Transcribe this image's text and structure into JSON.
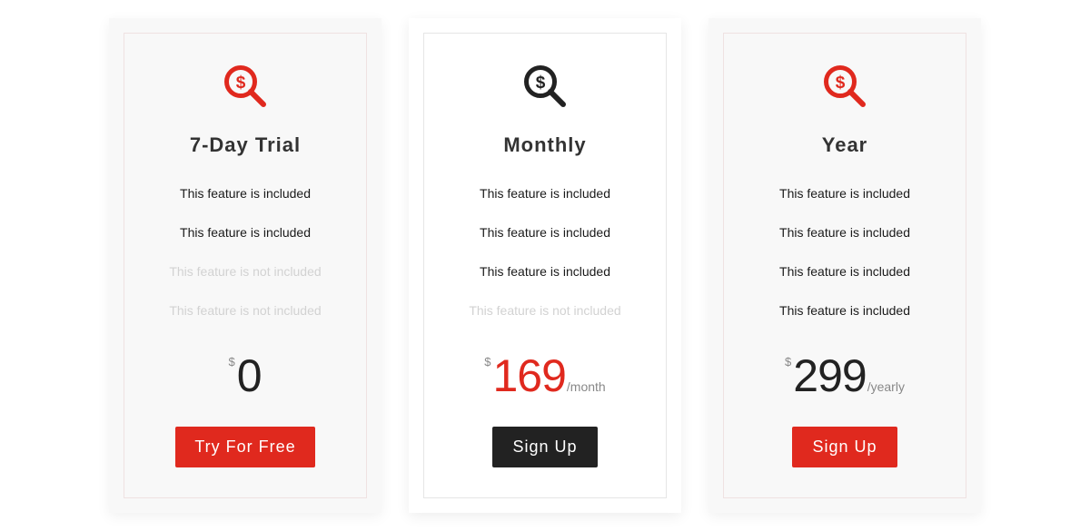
{
  "colors": {
    "accent": "#e0291e",
    "dark": "#222222",
    "disabled_text": "#d2d2d2",
    "card_bg": "#f8f8f8"
  },
  "plans": [
    {
      "icon": "dollar-search-icon",
      "icon_color": "#e0291e",
      "title": "7-Day Trial",
      "features": [
        {
          "text": "This feature is included",
          "included": true
        },
        {
          "text": "This feature is included",
          "included": true
        },
        {
          "text": "This feature is not included",
          "included": false
        },
        {
          "text": "This feature is not included",
          "included": false
        }
      ],
      "currency": "$",
      "amount": "0",
      "period": "",
      "button_label": "Try For Free"
    },
    {
      "icon": "dollar-search-icon",
      "icon_color": "#222222",
      "title": "Monthly",
      "features": [
        {
          "text": "This feature is included",
          "included": true
        },
        {
          "text": "This feature is included",
          "included": true
        },
        {
          "text": "This feature is included",
          "included": true
        },
        {
          "text": "This feature is not included",
          "included": false
        }
      ],
      "currency": "$",
      "amount": "169",
      "period": "/month",
      "button_label": "Sign Up"
    },
    {
      "icon": "dollar-search-icon",
      "icon_color": "#e0291e",
      "title": "Year",
      "features": [
        {
          "text": "This feature is included",
          "included": true
        },
        {
          "text": "This feature is included",
          "included": true
        },
        {
          "text": "This feature is included",
          "included": true
        },
        {
          "text": "This feature is included",
          "included": true
        }
      ],
      "currency": "$",
      "amount": "299",
      "period": "/yearly",
      "button_label": "Sign Up"
    }
  ]
}
